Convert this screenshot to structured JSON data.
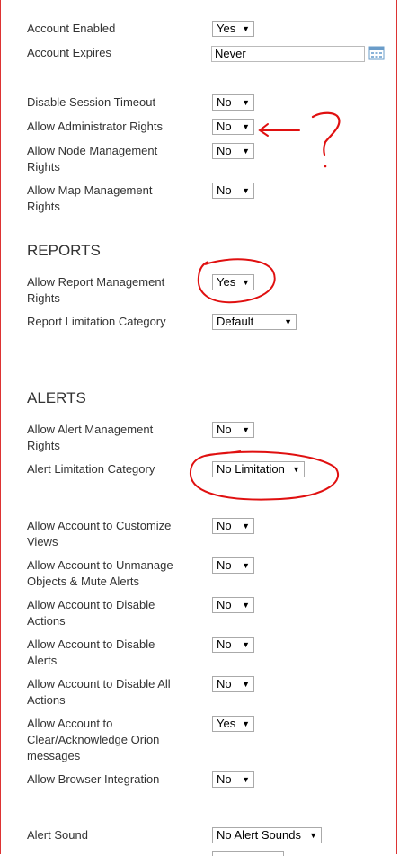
{
  "rows": {
    "account_enabled": {
      "label": "Account Enabled",
      "value": "Yes"
    },
    "account_expires": {
      "label": "Account Expires",
      "value": "Never"
    },
    "disable_session_timeout": {
      "label": "Disable Session Timeout",
      "value": "No"
    },
    "allow_admin_rights": {
      "label": "Allow Administrator Rights",
      "value": "No"
    },
    "allow_node_mgmt": {
      "label1": "Allow Node Management",
      "label2": "Rights",
      "value": "No"
    },
    "allow_map_mgmt": {
      "label1": "Allow Map Management",
      "label2": "Rights",
      "value": "No"
    },
    "allow_report_mgmt": {
      "label1": "Allow Report Management",
      "label2": "Rights",
      "value": "Yes"
    },
    "report_limit_cat": {
      "label": "Report Limitation Category",
      "value": "Default"
    },
    "allow_alert_mgmt": {
      "label1": "Allow Alert Management",
      "label2": "Rights",
      "value": "No"
    },
    "alert_limit_cat": {
      "label": "Alert Limitation Category",
      "value": "No Limitation"
    },
    "customize_views": {
      "label1": "Allow Account to Customize",
      "label2": "Views",
      "value": "No"
    },
    "unmanage_objects": {
      "label1": "Allow Account to Unmanage",
      "label2": "Objects & Mute Alerts",
      "value": "No"
    },
    "disable_actions": {
      "label1": "Allow Account to Disable",
      "label2": "Actions",
      "value": "No"
    },
    "disable_alerts": {
      "label1": "Allow Account to Disable",
      "label2": "Alerts",
      "value": "No"
    },
    "disable_all_actions": {
      "label1": "Allow Account to Disable All",
      "label2": "Actions",
      "value": "No"
    },
    "clear_ack": {
      "label1": "Allow Account to",
      "label2": "Clear/Acknowledge Orion",
      "label3": "messages",
      "value": "Yes"
    },
    "browser_integration": {
      "label": "Allow Browser Integration",
      "value": "No"
    },
    "alert_sound": {
      "label": "Alert Sound",
      "value": "No Alert Sounds"
    }
  },
  "sections": {
    "reports": "REPORTS",
    "alerts": "ALERTS"
  },
  "annotation": {
    "question_mark": "?"
  },
  "icons": {
    "dropdown": "caret-down-icon",
    "calendar": "calendar-icon"
  },
  "colors": {
    "annotation": "#e01010"
  }
}
